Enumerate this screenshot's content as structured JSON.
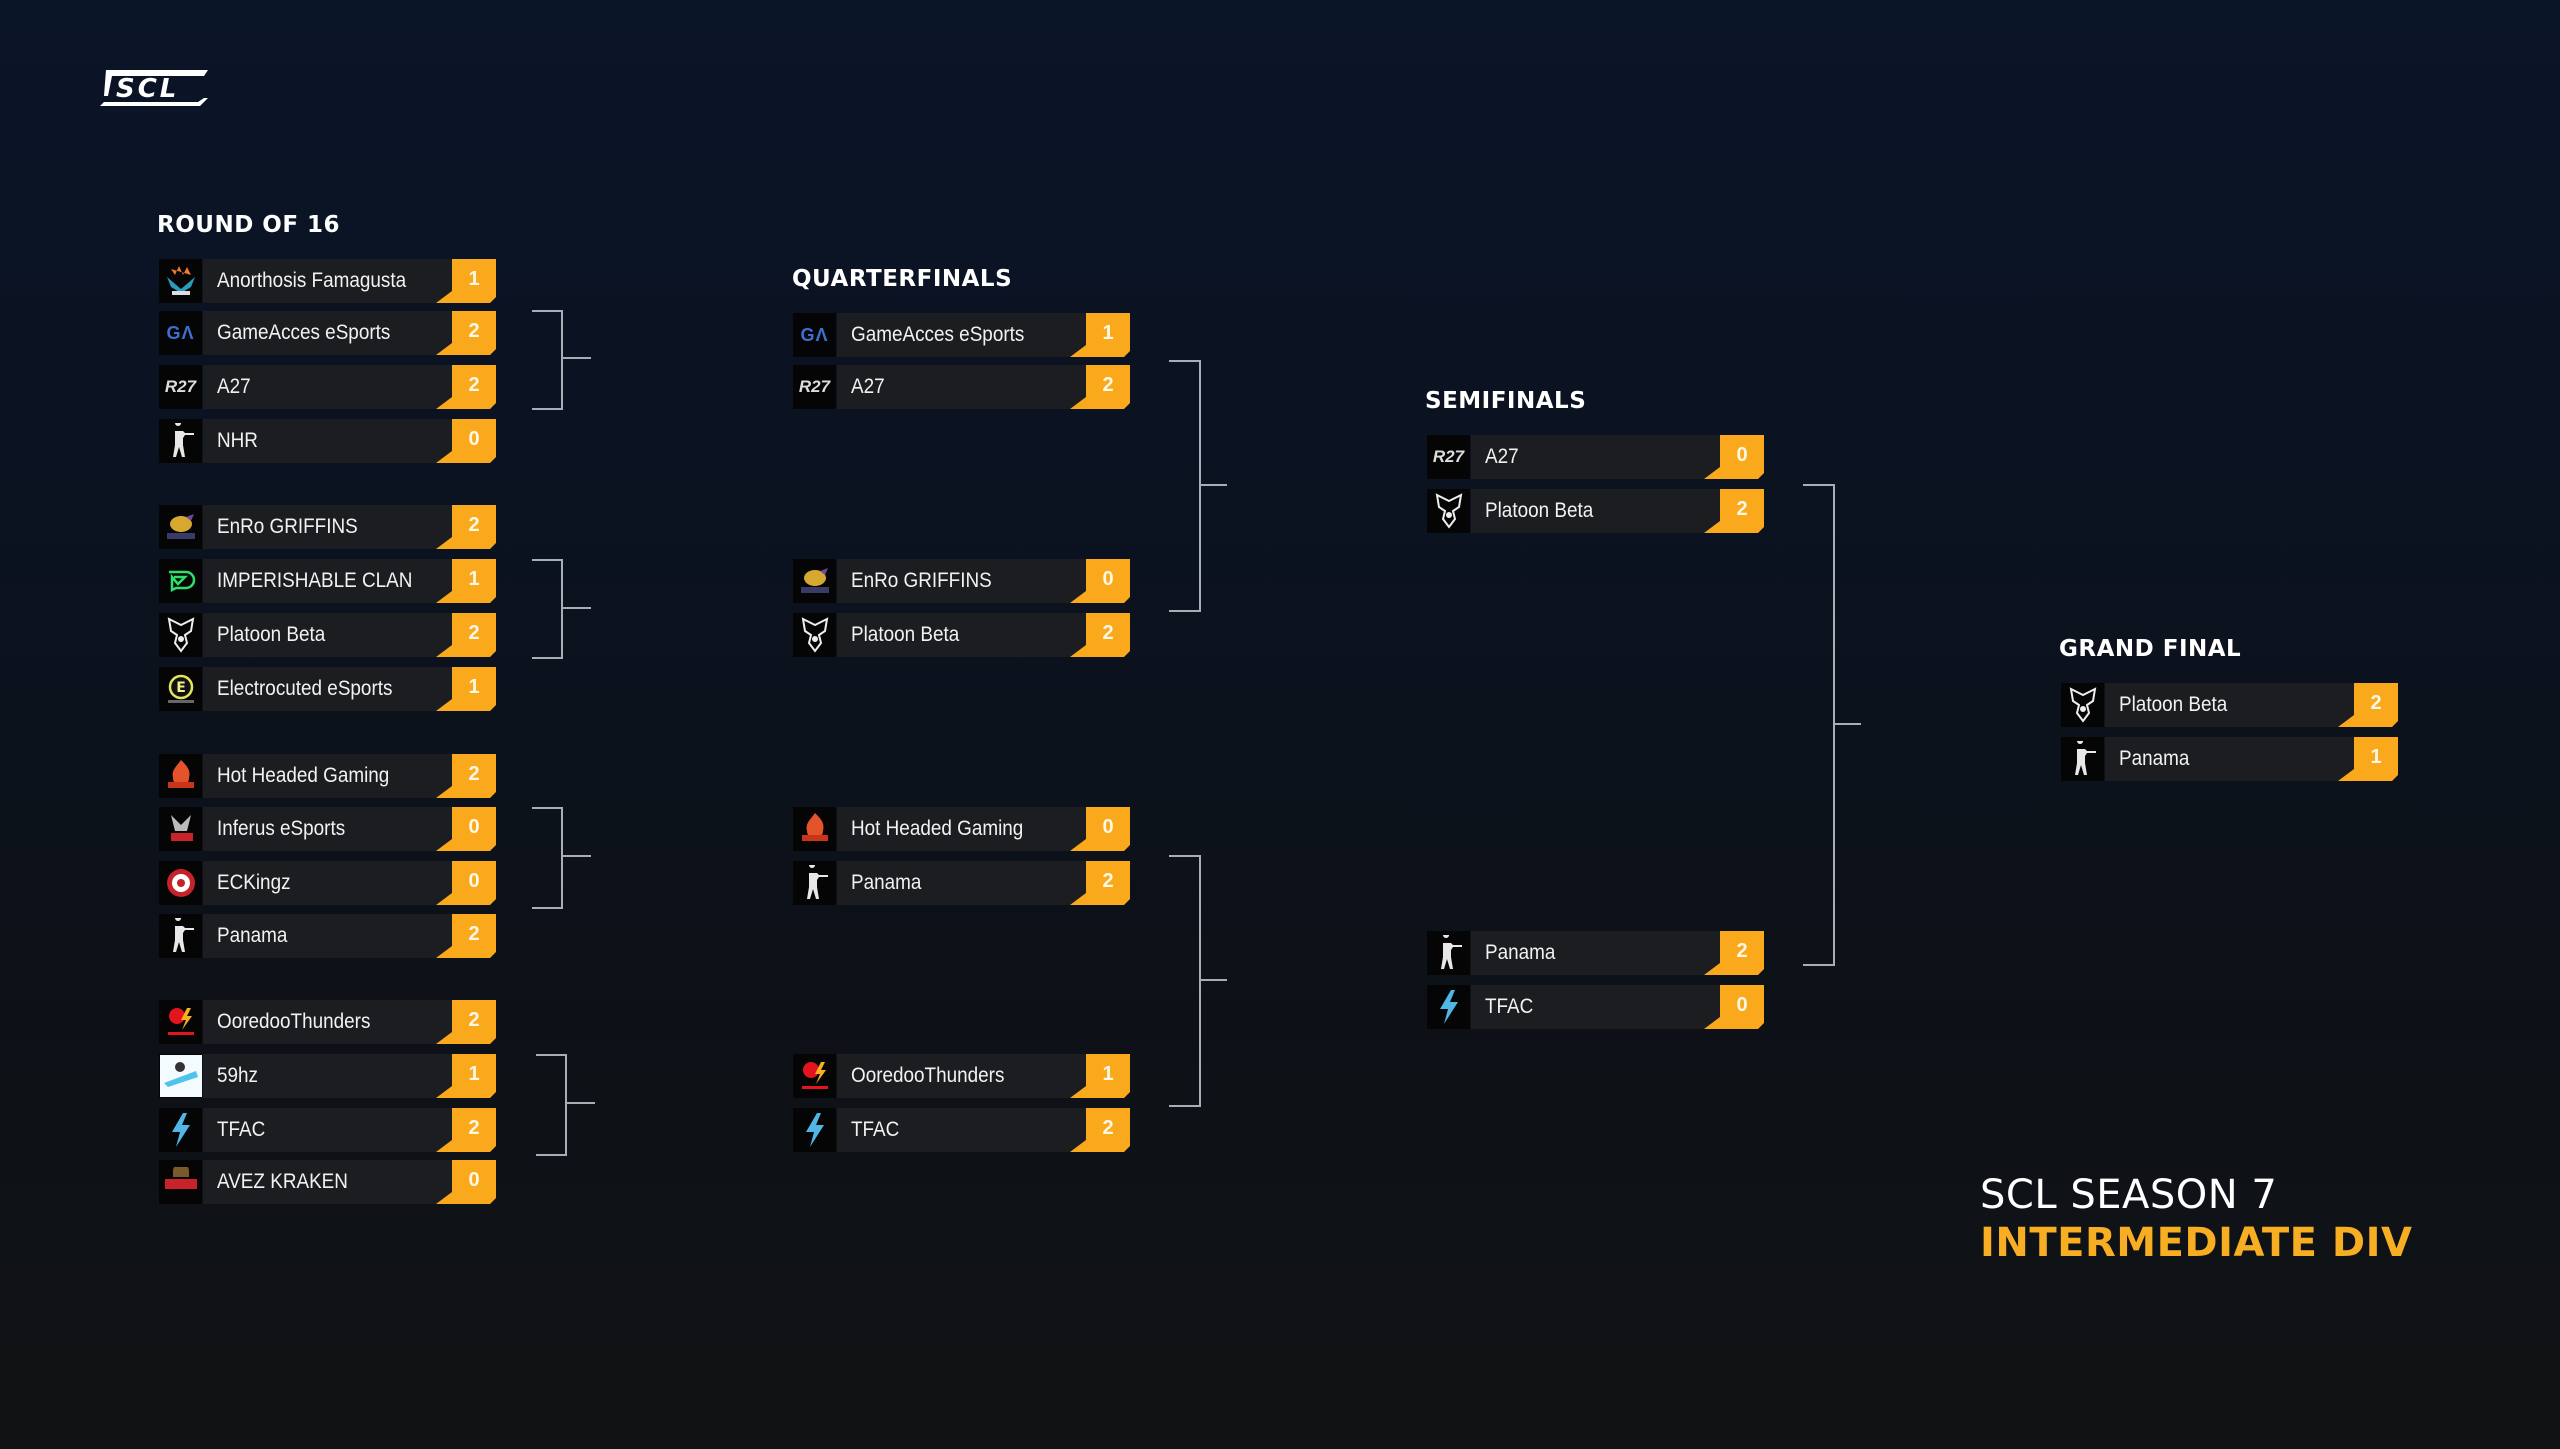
{
  "brand": {
    "logo_text": "SCL",
    "accent_color": "#F9A91B"
  },
  "rounds": {
    "round_of_16": {
      "title": "ROUND OF 16",
      "teams": [
        {
          "name": "Anorthosis Famagusta",
          "score": "1",
          "icon": "anorthosis-logo"
        },
        {
          "name": "GameAcces eSports",
          "score": "2",
          "icon": "gameacces-logo"
        },
        {
          "name": "A27",
          "score": "2",
          "icon": "a27-logo"
        },
        {
          "name": "NHR",
          "score": "0",
          "icon": "soldier-logo"
        },
        {
          "name": "EnRo GRIFFINS",
          "score": "2",
          "icon": "griffins-logo"
        },
        {
          "name": "IMPERISHABLE CLAN",
          "score": "1",
          "icon": "imperishable-logo"
        },
        {
          "name": "Platoon Beta",
          "score": "2",
          "icon": "platoon-beta-logo"
        },
        {
          "name": "Electrocuted eSports",
          "score": "1",
          "icon": "electrocuted-logo"
        },
        {
          "name": "Hot Headed Gaming",
          "score": "2",
          "icon": "hot-headed-logo"
        },
        {
          "name": "Inferus eSports",
          "score": "0",
          "icon": "inferus-logo"
        },
        {
          "name": "ECKingz",
          "score": "0",
          "icon": "eckingz-logo"
        },
        {
          "name": "Panama",
          "score": "2",
          "icon": "soldier-logo"
        },
        {
          "name": "OoredooThunders",
          "score": "2",
          "icon": "ooredoo-logo"
        },
        {
          "name": "59hz",
          "score": "1",
          "icon": "59hz-logo"
        },
        {
          "name": "TFAC",
          "score": "2",
          "icon": "lightning-logo"
        },
        {
          "name": "AVEZ KRAKEN",
          "score": "0",
          "icon": "kraken-logo"
        }
      ]
    },
    "quarterfinals": {
      "title": "QUARTERFINALS",
      "teams": [
        {
          "name": "GameAcces eSports",
          "score": "1",
          "icon": "gameacces-logo"
        },
        {
          "name": "A27",
          "score": "2",
          "icon": "a27-logo"
        },
        {
          "name": "EnRo GRIFFINS",
          "score": "0",
          "icon": "griffins-logo"
        },
        {
          "name": "Platoon Beta",
          "score": "2",
          "icon": "platoon-beta-logo"
        },
        {
          "name": "Hot Headed Gaming",
          "score": "0",
          "icon": "hot-headed-logo"
        },
        {
          "name": "Panama",
          "score": "2",
          "icon": "soldier-logo"
        },
        {
          "name": "OoredooThunders",
          "score": "1",
          "icon": "ooredoo-logo"
        },
        {
          "name": "TFAC",
          "score": "2",
          "icon": "lightning-logo"
        }
      ]
    },
    "semifinals": {
      "title": "SEMIFINALS",
      "teams": [
        {
          "name": "A27",
          "score": "0",
          "icon": "a27-logo"
        },
        {
          "name": "Platoon Beta",
          "score": "2",
          "icon": "platoon-beta-logo"
        },
        {
          "name": "Panama",
          "score": "2",
          "icon": "soldier-logo"
        },
        {
          "name": "TFAC",
          "score": "0",
          "icon": "lightning-logo"
        }
      ]
    },
    "grand_final": {
      "title": "GRAND FINAL",
      "teams": [
        {
          "name": "Platoon Beta",
          "score": "2",
          "icon": "platoon-beta-logo"
        },
        {
          "name": "Panama",
          "score": "1",
          "icon": "soldier-logo"
        }
      ]
    }
  },
  "season": {
    "line1": "SCL SEASON 7",
    "line2": "INTERMEDIATE DIV"
  }
}
